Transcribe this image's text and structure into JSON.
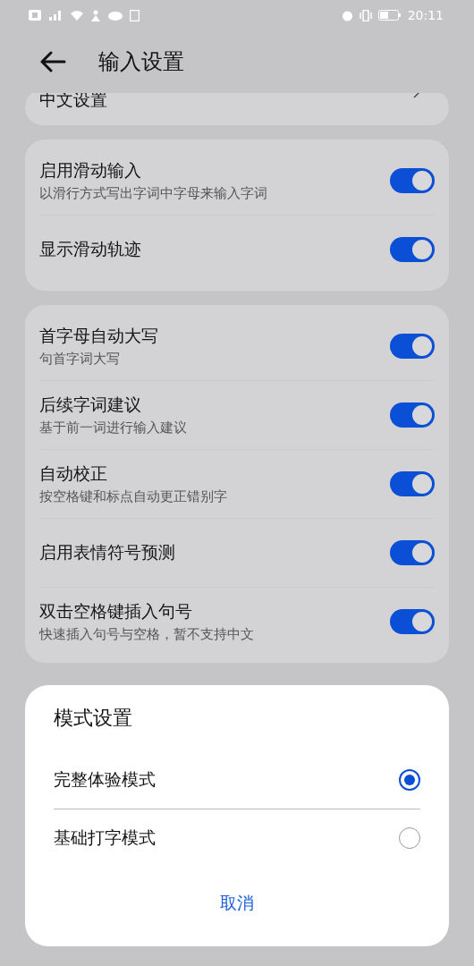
{
  "status_bar": {
    "time": "20:11"
  },
  "header": {
    "title": "输入设置"
  },
  "partial_item": {
    "label": "中文设置"
  },
  "groups": [
    {
      "items": [
        {
          "title": "启用滑动输入",
          "subtitle": "以滑行方式写出字词中字母来输入字词",
          "on": true
        },
        {
          "title": "显示滑动轨迹",
          "on": true
        }
      ]
    },
    {
      "items": [
        {
          "title": "首字母自动大写",
          "subtitle": "句首字词大写",
          "on": true
        },
        {
          "title": "后续字词建议",
          "subtitle": "基于前一词进行输入建议",
          "on": true
        },
        {
          "title": "自动校正",
          "subtitle": "按空格键和标点自动更正错别字",
          "on": true
        },
        {
          "title": "启用表情符号预测",
          "on": true
        },
        {
          "title": "双击空格键插入句号",
          "subtitle": "快速插入句号与空格，暂不支持中文",
          "on": true
        }
      ]
    }
  ],
  "dialog": {
    "title": "模式设置",
    "options": [
      {
        "label": "完整体验模式",
        "selected": true
      },
      {
        "label": "基础打字模式",
        "selected": false
      }
    ],
    "cancel": "取消"
  }
}
